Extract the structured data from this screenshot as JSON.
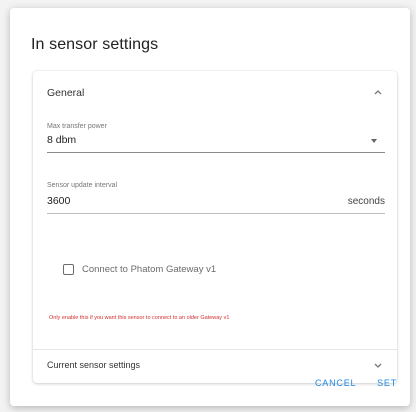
{
  "dialog": {
    "title": "In sensor settings"
  },
  "general_panel": {
    "title": "General",
    "expanded": true,
    "chevron_icon": "chevron-up-icon",
    "max_transfer_power": {
      "label": "Max transfer power",
      "value": "8 dbm",
      "dropdown_icon": "caret-down-icon"
    },
    "sensor_update_interval": {
      "label": "Sensor update interval",
      "value": "3600",
      "suffix": "seconds"
    },
    "gateway_checkbox": {
      "label": "Connect to Phatom Gateway v1",
      "checked": false
    },
    "warning": "Only enable this if you want this sensor to connect to an older Gateway v1"
  },
  "current_panel": {
    "title": "Current sensor settings",
    "expanded": false,
    "chevron_icon": "chevron-down-icon"
  },
  "actions": {
    "cancel_label": "CANCEL",
    "set_label": "SET"
  },
  "colors": {
    "accent": "#1e88e5",
    "warning": "#d32f2f",
    "background": "#f3f3f3"
  }
}
